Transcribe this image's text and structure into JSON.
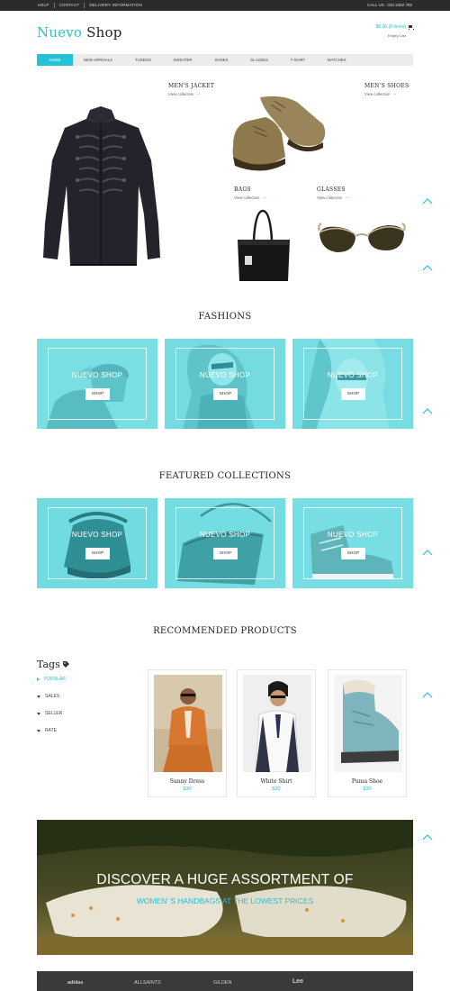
{
  "topbar": {
    "links": [
      "HELP",
      "CONTACT",
      "DELIVERY INFORMATION"
    ],
    "call": "CALL US : 032 2352 782"
  },
  "header": {
    "logo_part1": "Nuevo",
    "logo_part2": "Shop",
    "cart_amount": "$0.00 (0 items)",
    "cart_status": "Empty Cart",
    "cart_icon": "cart-icon"
  },
  "nav": {
    "items": [
      "HOME",
      "NEW ARRIVALS",
      "TUXEDO",
      "SWEATER",
      "SHOES",
      "GLASSES",
      "T-SHIRT",
      "WATCHES"
    ],
    "active": "HOME"
  },
  "hero": {
    "mens_jacket": {
      "title": "MEN'S JACKET",
      "link": "View collection"
    },
    "mens_shoes": {
      "title": "MEN'S SHOES",
      "link": "View collection"
    },
    "bags": {
      "title": "BAGS",
      "link": "View collection"
    },
    "glasses": {
      "title": "GLASSES",
      "link": "View collection"
    }
  },
  "fashions": {
    "title": "FASHIONS",
    "tiles": [
      {
        "title": "NUEVO SHOP",
        "button": "SHOP"
      },
      {
        "title": "NUEVO SHOP",
        "button": "SHOP"
      },
      {
        "title": "NUEVO SHOP",
        "button": "SHOP"
      }
    ]
  },
  "featured": {
    "title": "FEATURED COLLECTIONS",
    "tiles": [
      {
        "title": "NUEVO SHOP",
        "button": "SHOP"
      },
      {
        "title": "NUEVO SHOP",
        "button": "SHOP"
      },
      {
        "title": "NUEVO SHOP",
        "button": "SHOP"
      }
    ]
  },
  "recommended": {
    "title": "RECOMMENDED PRODUCTS",
    "products": [
      {
        "name": "Sunny Dress",
        "price": "$30"
      },
      {
        "name": "White Shirt",
        "price": "$30"
      },
      {
        "name": "Puma Shoe",
        "price": "$30"
      }
    ]
  },
  "tags": {
    "title": "Tags",
    "items": [
      "POPULAR",
      "SALES",
      "SELLER",
      "RATE"
    ],
    "active": "POPULAR"
  },
  "banner": {
    "line1": "DISCOVER A HUGE ASSORTMENT OF",
    "line2": "WOMEN' S HANDBAGS AT THE LOWEST PRICES"
  },
  "brands": [
    "adidas",
    "ALLSAINTS",
    "GILDEN",
    "Lee"
  ],
  "colors": {
    "accent": "#25c1d6",
    "tile": "#72dde2",
    "topbar": "#2b2b2b",
    "nav_bg": "#ececec"
  }
}
